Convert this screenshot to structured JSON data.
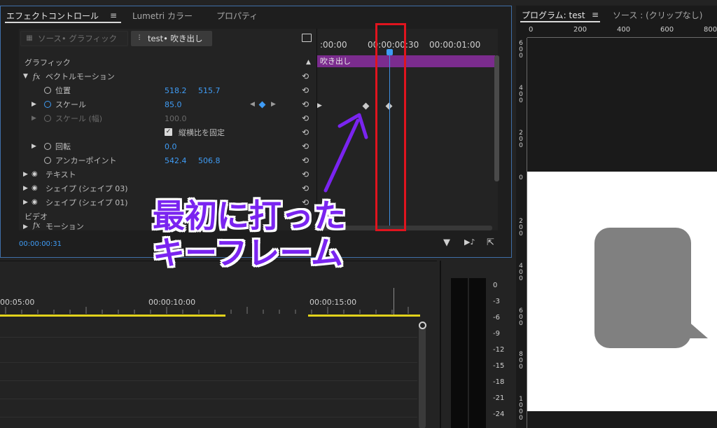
{
  "effect_controls": {
    "tabs": [
      "エフェクトコントロール",
      "Lumetri カラー",
      "プロパティ"
    ],
    "menu_glyph": "≡",
    "source_button": "ソース• グラフィック",
    "clip_button": "test• 吹き出し",
    "section_graphic": "グラフィック",
    "vector_motion": "ベクトルモーション",
    "rows": {
      "position": {
        "label": "位置",
        "x": "518.2",
        "y": "515.7"
      },
      "scale": {
        "label": "スケール",
        "value": "85.0"
      },
      "scale_width": {
        "label": "スケール (幅)",
        "value": "100.0"
      },
      "uniform_scale": {
        "label": "縦横比を固定"
      },
      "rotation": {
        "label": "回転",
        "value": "0.0"
      },
      "anchor": {
        "label": "アンカーポイント",
        "x": "542.4",
        "y": "506.8"
      }
    },
    "layers": [
      "テキスト",
      "シェイプ (シェイプ 03)",
      "シェイプ (シェイプ 01)"
    ],
    "section_video": "ビデオ",
    "motion": "モーション",
    "fx": "fx",
    "timecode": "00:00:00:31",
    "timeline": {
      "ruler_labels": [
        ":00:00",
        "00:00:00:30",
        "00:00:01:00"
      ],
      "clip_name": "吹き出し"
    }
  },
  "program_monitor": {
    "title": "プログラム: test",
    "menu_glyph": "≡",
    "source_tab": "ソース : (クリップなし)",
    "ruler_top": [
      "0",
      "200",
      "400",
      "600",
      "800"
    ],
    "ruler_left": [
      "6 0 0",
      "4 0 0",
      "2 0 0",
      "0",
      "2 0 0",
      "4 0 0",
      "6 0 0",
      "8 0 0",
      "1 0 0 0"
    ]
  },
  "timeline": {
    "time_labels": [
      "00:05:00",
      "00:00:10:00",
      "00:00:15:00"
    ]
  },
  "audio_meter": {
    "labels": [
      "0",
      "-3",
      "-6",
      "-9",
      "-12",
      "-15",
      "-18",
      "-21",
      "-24"
    ]
  },
  "annotation": {
    "line1": "最初に打った",
    "line2": "キーフレーム",
    "color": "#7a24f0",
    "box_color": "#e0141e"
  }
}
